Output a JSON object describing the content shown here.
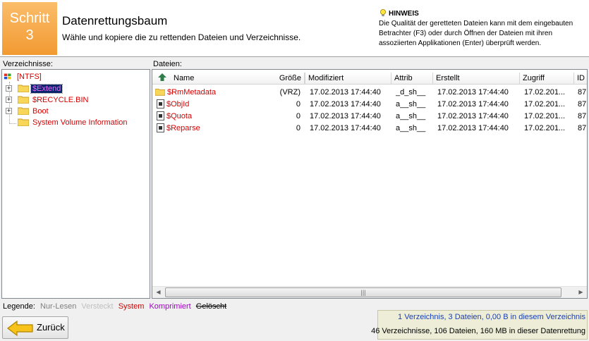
{
  "header": {
    "step_label": "Schritt",
    "step_number": "3",
    "title": "Datenrettungsbaum",
    "subtitle": "Wähle und kopiere die zu rettenden Dateien und Verzeichnisse.",
    "hint_title": "HINWEIS",
    "hint_text": "Die Qualität der geretteten Dateien kann mit dem eingebauten Betrachter (F3) oder durch Öffnen der Dateien mit ihren assoziierten Applikationen (Enter) überprüft werden."
  },
  "tree": {
    "label": "Verzeichnisse:",
    "root": "[NTFS]",
    "items": [
      {
        "label": "$Extend",
        "expander": "+",
        "selected": true
      },
      {
        "label": "$RECYCLE.BIN",
        "expander": "+",
        "selected": false
      },
      {
        "label": "Boot",
        "expander": "+",
        "selected": false
      },
      {
        "label": "System Volume Information",
        "expander": "",
        "selected": false
      }
    ]
  },
  "files": {
    "label": "Dateien:",
    "columns": {
      "name": "Name",
      "size": "Größe",
      "modified": "Modifiziert",
      "attrib": "Attrib",
      "created": "Erstellt",
      "accessed": "Zugriff",
      "id": "ID"
    },
    "rows": [
      {
        "name": "$RmMetadata",
        "type": "folder",
        "size": "(VRZ)",
        "modified": "17.02.2013 17:44:40",
        "attrib": "_d_sh__",
        "created": "17.02.2013 17:44:40",
        "accessed": "17.02.201...",
        "id": "87"
      },
      {
        "name": "$ObjId",
        "type": "file",
        "size": "0",
        "modified": "17.02.2013 17:44:40",
        "attrib": "a__sh__",
        "created": "17.02.2013 17:44:40",
        "accessed": "17.02.201...",
        "id": "87"
      },
      {
        "name": "$Quota",
        "type": "file",
        "size": "0",
        "modified": "17.02.2013 17:44:40",
        "attrib": "a__sh__",
        "created": "17.02.2013 17:44:40",
        "accessed": "17.02.201...",
        "id": "87"
      },
      {
        "name": "$Reparse",
        "type": "file",
        "size": "0",
        "modified": "17.02.2013 17:44:40",
        "attrib": "a__sh__",
        "created": "17.02.2013 17:44:40",
        "accessed": "17.02.201...",
        "id": "87"
      }
    ]
  },
  "legend": {
    "label": "Legende:",
    "items": [
      {
        "text": "Nur-Lesen",
        "color": "#808080"
      },
      {
        "text": "Versteckt",
        "color": "#c0c0c0"
      },
      {
        "text": "System",
        "color": "#d40000"
      },
      {
        "text": "Komprimiert",
        "color": "#a000c0"
      },
      {
        "text": "Gelöscht",
        "color": "#000000"
      }
    ]
  },
  "back_button": {
    "label": "Zurück"
  },
  "status": {
    "line1": "1 Verzeichnis, 3 Dateien, 0,00 B in diesem Verzeichnis",
    "line2": "46 Verzeichnisse, 106 Dateien, 160 MB in dieser Datenrettung"
  },
  "colors": {
    "step_box": "#f5a444",
    "system_text": "#d40000",
    "selection": "#0a246a",
    "status_line1": "#1a3fb0"
  }
}
